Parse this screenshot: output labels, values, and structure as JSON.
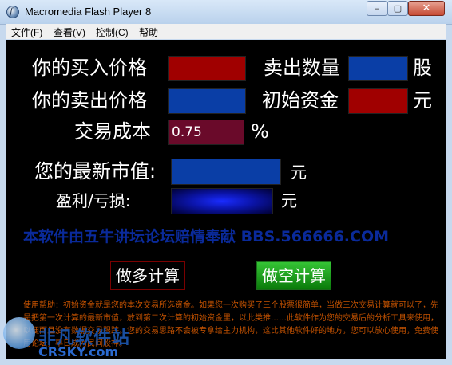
{
  "window": {
    "title": "Macromedia Flash Player 8",
    "min_glyph": "–",
    "max_glyph": "▢",
    "close_glyph": "✕"
  },
  "menu": [
    {
      "label": "文件(F)"
    },
    {
      "label": "查看(V)"
    },
    {
      "label": "控制(C)"
    },
    {
      "label": "帮助"
    }
  ],
  "form": {
    "buy_price_label": "你的买入价格",
    "sell_qty_label": "卖出数量",
    "shares_unit": "股",
    "sell_price_label": "你的卖出价格",
    "initial_capital_label": "初始资金",
    "yuan_unit": "元",
    "cost_label": "交易成本",
    "cost_value": "0.75",
    "percent_unit": "%",
    "market_value_label": "您的最新市值:",
    "profit_label": "盈利/亏损:"
  },
  "banner": "本软件由五牛讲坛论坛赔情奉献    BBS.566666.COM",
  "buttons": {
    "long_calc": "做多计算",
    "short_calc": "做空计算"
  },
  "help_text": "使用帮助：初始资金就是您的本次交易所选资金。如果您一次购买了三个股票很简单，当做三次交易计算就可以了，先是把第一次计算的最新市值，放到第二次计算的初始资金里，以此类推……此软件作为您的交易后的分析工具来使用，以便而且没有数据交易跟踪。您的交易思路不会被专拿给主力机构，这比其他软件好的地方，您可以放心使用，免费使用论坛，早日成为民间股神。",
  "watermark": {
    "cn": "非凡软件站",
    "en": "CRSKY.com"
  },
  "colors": {
    "red_field": "#a00000",
    "blue_field": "#0a3ea6",
    "cost_field": "#6a0a2a",
    "help_text": "#c45200",
    "banner": "#0a2a9a"
  }
}
